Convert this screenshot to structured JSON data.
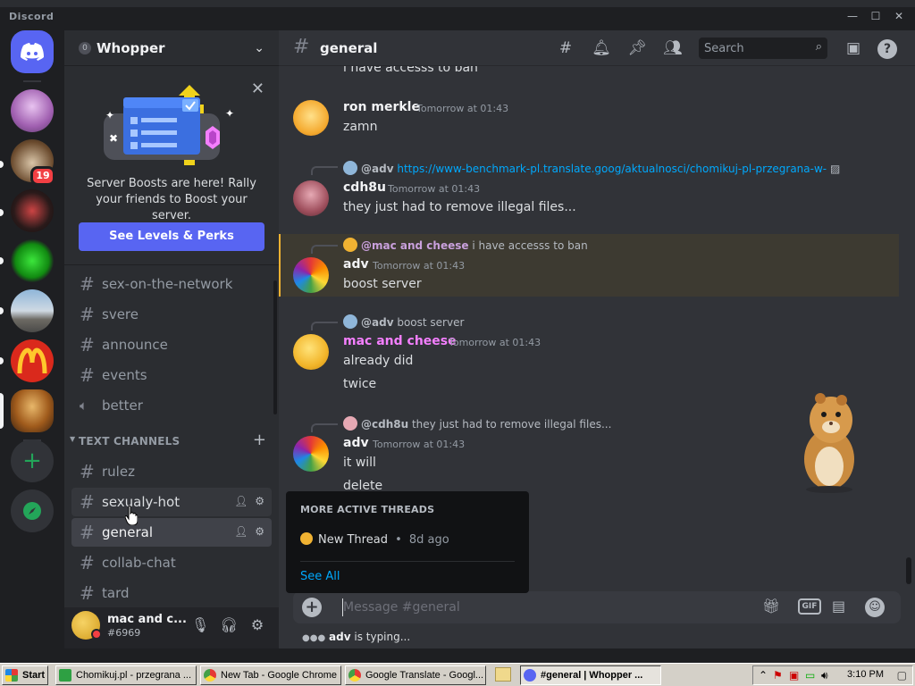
{
  "window": {
    "title": "Discord"
  },
  "server": {
    "name": "Whopper"
  },
  "promo": {
    "text": "Server Boosts are here! Rally your friends to Boost your server.",
    "button": "See Levels & Perks"
  },
  "rail": {
    "badge_count": "19"
  },
  "sidebar": {
    "channels_top": [
      {
        "name": "sex-on-the-network"
      },
      {
        "name": "svere"
      },
      {
        "name": "announce"
      },
      {
        "name": "events"
      },
      {
        "name": "better"
      }
    ],
    "category": "TEXT CHANNELS",
    "text_channels": [
      {
        "name": "rulez"
      },
      {
        "name": "sexualy-hot"
      },
      {
        "name": "general"
      },
      {
        "name": "collab-chat"
      },
      {
        "name": "tard"
      }
    ]
  },
  "user": {
    "name": "mac and c...",
    "tag": "#6969"
  },
  "chat": {
    "channel": "general",
    "search_placeholder": "Search",
    "clipped_top_line": "i have accesss to ban",
    "messages": [
      {
        "author": "ron merkle",
        "time": "Tomorrow at 01:43",
        "lines": [
          "zamn"
        ],
        "author_color": "#f2f3f5"
      },
      {
        "reply_mention": "@adv",
        "reply_text": "https://www-benchmark-pl.translate.goog/aktualnosci/chomikuj-pl-przegrana-w-",
        "author": "cdh8u",
        "time": "Tomorrow at 01:43",
        "lines": [
          "they just had to remove illegal files..."
        ],
        "author_color": "#f2f3f5"
      },
      {
        "reply_mention": "@mac and cheese",
        "reply_text": "i have accesss to ban",
        "author": "adv",
        "time": "Tomorrow at 01:43",
        "lines": [
          "boost server"
        ],
        "author_color": "#f2f3f5"
      },
      {
        "reply_mention": "@adv",
        "reply_text": "boost server",
        "author": "mac and cheese",
        "time": "Tomorrow at 01:43",
        "lines": [
          "already did",
          "twice"
        ],
        "author_color": "#f47fff"
      },
      {
        "reply_mention": "@cdh8u",
        "reply_text": "they just had to remove illegal files...",
        "author": "adv",
        "time": "Tomorrow at 01:43",
        "lines": [
          "it will",
          "delete"
        ],
        "author_color": "#f2f3f5"
      }
    ],
    "threads_popup": {
      "heading": "MORE ACTIVE THREADS",
      "thread_name": "New Thread",
      "thread_sep": "•",
      "thread_age": "8d ago",
      "see_all": "See All"
    },
    "composer_placeholder": "Message #general",
    "typing_user": "adv",
    "typing_suffix": "is typing..."
  },
  "taskbar": {
    "start": "Start",
    "items": [
      {
        "label": "Chomikuj.pl - przegrana ..."
      },
      {
        "label": "New Tab - Google Chrome"
      },
      {
        "label": "Google Translate - Googl..."
      },
      {
        "label": "#general | Whopper ..."
      }
    ],
    "clock": "3:10 PM"
  },
  "colors": {
    "accent": "#5865f2",
    "link": "#00a8fc",
    "mention_highlight": "#f0b232",
    "danger": "#f23f43",
    "online_green": "#23a559"
  }
}
